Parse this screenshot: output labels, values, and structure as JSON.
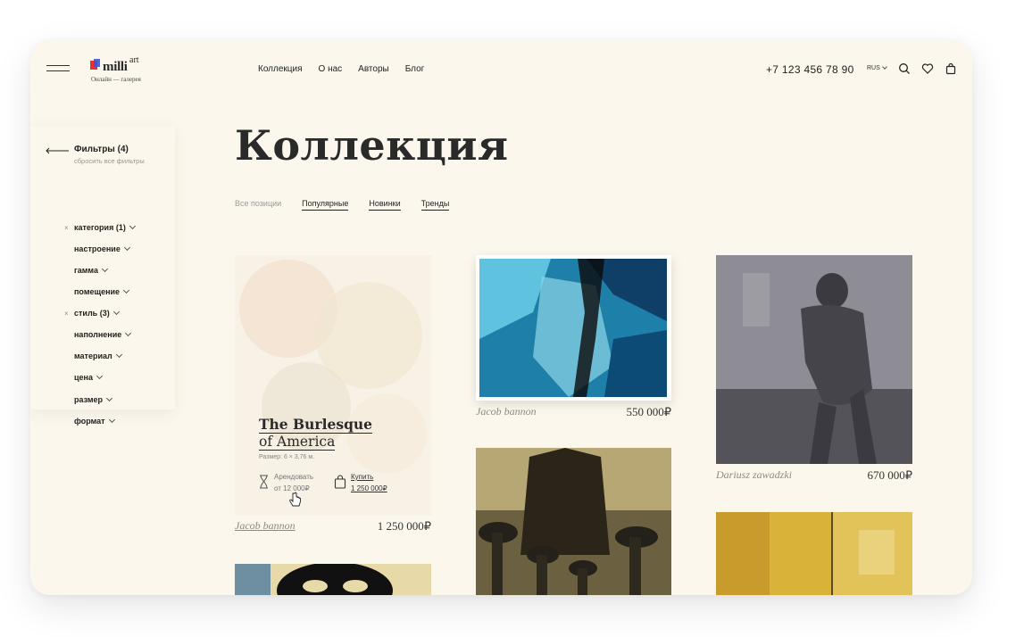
{
  "brand": {
    "name": "milli",
    "sup": "art",
    "tagline": "Онлайн — галерея"
  },
  "nav": [
    "Коллекция",
    "О нас",
    "Авторы",
    "Блог"
  ],
  "header": {
    "phone": "+7 123 456 78 90",
    "lang": "RUS"
  },
  "filters": {
    "title": "Фильтры (4)",
    "reset": "сбросить все фильтры",
    "items": [
      {
        "label": "категория (1)",
        "removable": true
      },
      {
        "label": "настроение",
        "removable": false
      },
      {
        "label": "гамма",
        "removable": false
      },
      {
        "label": "помещение",
        "removable": false
      },
      {
        "label": "стиль (3)",
        "removable": true
      },
      {
        "label": "наполнение",
        "removable": false
      },
      {
        "label": "материал",
        "removable": false
      },
      {
        "label": "цена",
        "removable": false
      },
      {
        "label": "размер",
        "removable": false
      },
      {
        "label": "формат",
        "removable": false
      }
    ]
  },
  "page": {
    "title": "Коллекция"
  },
  "tabs": [
    {
      "label": "Все позиции",
      "active": false
    },
    {
      "label": "Популярные",
      "active": true
    },
    {
      "label": "Новинки",
      "active": true
    },
    {
      "label": "Тренды",
      "active": true
    }
  ],
  "cards": [
    {
      "artist": "Jacob bannon",
      "price": "1 250 000₽",
      "hover": {
        "title1": "The Burlesque",
        "title2": "of America",
        "size": "Размер: 6 × 3,76 м.",
        "rent_label": "Арендовать",
        "rent_price": "от 12 000₽",
        "buy_label": "Купить",
        "buy_price": "1 250 000₽"
      }
    },
    {
      "artist": "Jacob bannon",
      "price": "550 000₽"
    },
    {
      "artist": "Dariusz zawadzki",
      "price": "670 000₽"
    }
  ],
  "colors": {
    "background": "#fbf7ec",
    "text": "#222222",
    "muted": "#8f8a80"
  }
}
